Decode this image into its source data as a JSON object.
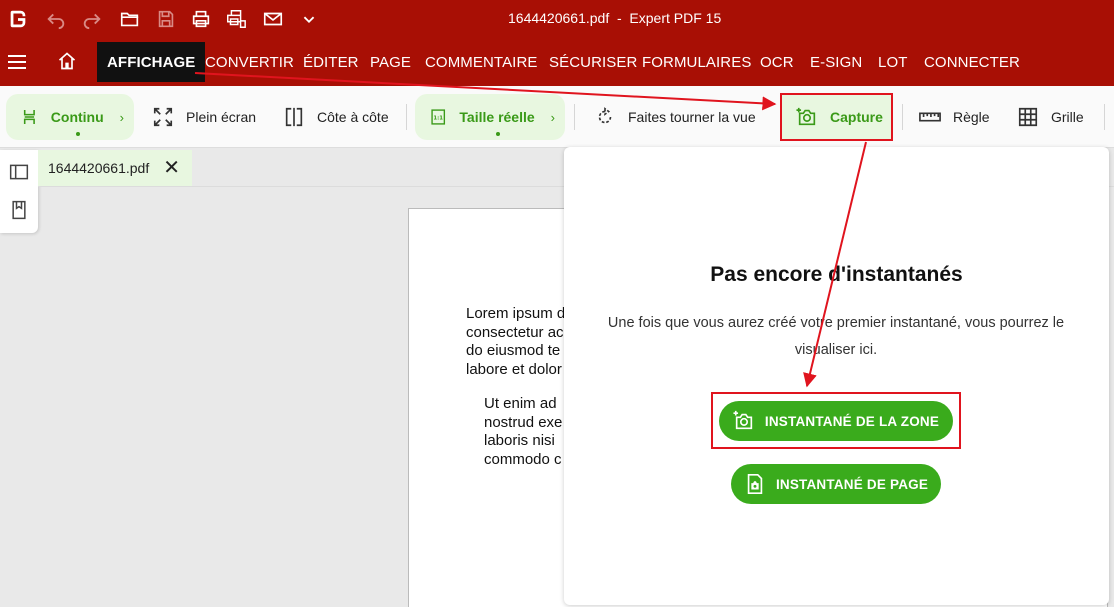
{
  "window": {
    "title": "1644420661.pdf  -  Expert PDF 15"
  },
  "quick_access": {
    "icons": [
      "logo-icon",
      "undo-icon",
      "redo-icon",
      "open-folder-icon",
      "save-icon",
      "print-icon",
      "print-setup-icon",
      "mail-icon",
      "chevron-down-icon"
    ]
  },
  "menu": {
    "items": [
      "AFFICHAGE",
      "CONVERTIR",
      "ÉDITER",
      "PAGE",
      "COMMENTAIRE",
      "SÉCURISER",
      "FORMULAIRES",
      "OCR",
      "E-SIGN",
      "LOT",
      "CONNECTER"
    ],
    "active": "AFFICHAGE"
  },
  "toolbar": {
    "continu": "Continu",
    "plein_ecran": "Plein écran",
    "cote_a_cote": "Côte à côte",
    "taille_reelle": "Taille réelle",
    "rotate": "Faites tourner la vue",
    "capture": "Capture",
    "regle": "Règle",
    "grille": "Grille"
  },
  "document_tab": {
    "filename": "1644420661.pdf",
    "close_glyph": "✕"
  },
  "document": {
    "para1": "Lorem ipsum d\nconsectetur ac\ndo eiusmod te\nlabore et dolor",
    "para2": "Ut enim ad\nnostrud exe\nlaboris nisi\ncommodo c"
  },
  "snapshot_panel": {
    "title": "Pas encore d'instantanés",
    "description": "Une fois que vous aurez créé votre premier instantané, vous pourrez le visualiser ici.",
    "zone_button": "INSTANTANÉ DE LA ZONE",
    "page_button": "INSTANTANÉ DE PAGE"
  },
  "colors": {
    "brand_red": "#a80f05",
    "accent_green": "#3aab1c",
    "highlight_red": "#e0141e"
  }
}
